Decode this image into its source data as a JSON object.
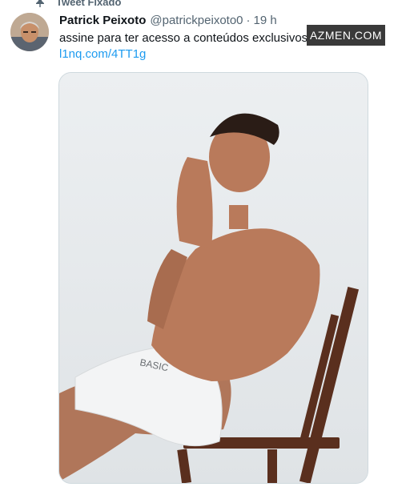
{
  "pinned": {
    "label": "Tweet Fixado",
    "icon": "pin-icon"
  },
  "tweet": {
    "display_name": "Patrick Peixoto",
    "handle": "@patrickpeixoto0",
    "separator": "·",
    "time": "19 h",
    "text": "assine para ter acesso a conteúdos exclusivos",
    "link": "l1nq.com/4TT1g"
  },
  "watermark": "AZMEN.COM",
  "photo": {
    "brand_text": "BASIC"
  },
  "colors": {
    "text_primary": "#0f1419",
    "text_secondary": "#536471",
    "link": "#1d9bf0",
    "border": "#cfd9de"
  }
}
